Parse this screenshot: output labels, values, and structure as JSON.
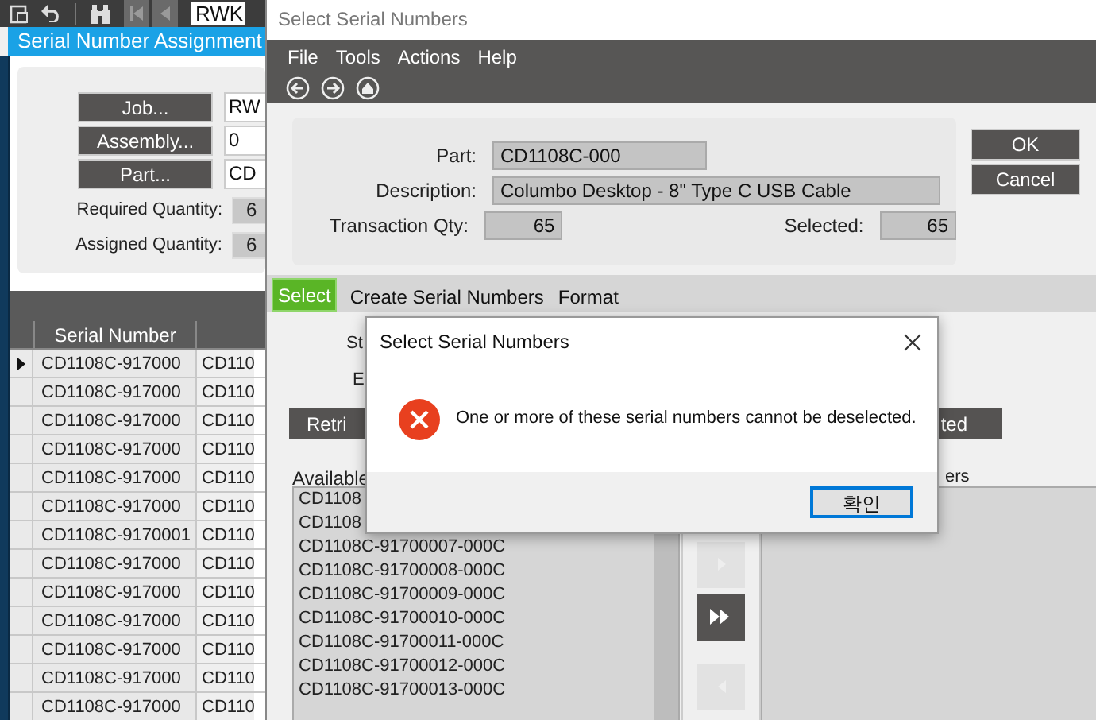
{
  "main_window": {
    "toolbar_field": "RWK",
    "title": "Serial Number Assignment",
    "lookups": [
      {
        "button": "Job...",
        "value": "RW"
      },
      {
        "button": "Assembly...",
        "value": "0"
      },
      {
        "button": "Part...",
        "value": "CD"
      }
    ],
    "quantities": [
      {
        "label": "Required Quantity:",
        "value": "6"
      },
      {
        "label": "Assigned Quantity:",
        "value": "6"
      }
    ],
    "grid": {
      "columns": [
        "Serial Number"
      ],
      "rows": [
        {
          "selected": true,
          "cells": [
            "CD1108C-917000",
            "CD110"
          ]
        },
        {
          "selected": false,
          "cells": [
            "CD1108C-917000",
            "CD110"
          ]
        },
        {
          "selected": false,
          "cells": [
            "CD1108C-917000",
            "CD110"
          ]
        },
        {
          "selected": false,
          "cells": [
            "CD1108C-917000",
            "CD110"
          ]
        },
        {
          "selected": false,
          "cells": [
            "CD1108C-917000",
            "CD110"
          ]
        },
        {
          "selected": false,
          "cells": [
            "CD1108C-917000",
            "CD110"
          ]
        },
        {
          "selected": false,
          "cells": [
            "CD1108C-9170001",
            "CD110"
          ]
        },
        {
          "selected": false,
          "cells": [
            "CD1108C-917000",
            "CD110"
          ]
        },
        {
          "selected": false,
          "cells": [
            "CD1108C-917000",
            "CD110"
          ]
        },
        {
          "selected": false,
          "cells": [
            "CD1108C-917000",
            "CD110"
          ]
        },
        {
          "selected": false,
          "cells": [
            "CD1108C-917000",
            "CD110"
          ]
        },
        {
          "selected": false,
          "cells": [
            "CD1108C-917000",
            "CD110"
          ]
        },
        {
          "selected": false,
          "cells": [
            "CD1108C-917000",
            "CD110"
          ]
        }
      ]
    }
  },
  "select_window": {
    "title": "Select Serial Numbers",
    "menu": [
      "File",
      "Tools",
      "Actions",
      "Help"
    ],
    "part": {
      "label": "Part:",
      "value": "CD1108C-000"
    },
    "description": {
      "label": "Description:",
      "value": "Columbo Desktop - 8\" Type C USB Cable"
    },
    "transaction_qty": {
      "label": "Transaction Qty:",
      "value": "65"
    },
    "selected_qty": {
      "label": "Selected:",
      "value": "65"
    },
    "buttons": [
      "OK",
      "Cancel"
    ],
    "tabs": [
      {
        "label": "Select",
        "selected": true
      },
      {
        "label": "Create Serial Numbers",
        "selected": false
      },
      {
        "label": "Format",
        "selected": false
      }
    ],
    "field_label_1": "St",
    "field_label_2": "E",
    "retrieve_button": "Retri",
    "right_button": "ted",
    "available_label": "Available",
    "selected_label": "ers",
    "available_list": [
      "CD1108",
      "CD1108",
      "CD1108C-91700007-000C",
      "CD1108C-91700008-000C",
      "CD1108C-91700009-000C",
      "CD1108C-91700010-000C",
      "CD1108C-91700011-000C",
      "CD1108C-91700012-000C",
      "CD1108C-91700013-000C"
    ],
    "move_buttons": [
      {
        "kind": "select",
        "disabled": true
      },
      {
        "kind": "select-all",
        "disabled": false
      },
      {
        "kind": "deselect",
        "disabled": true
      }
    ]
  },
  "dialog": {
    "title": "Select Serial Numbers",
    "message": "One or more of these serial numbers cannot be deselected.",
    "button": "확인"
  }
}
